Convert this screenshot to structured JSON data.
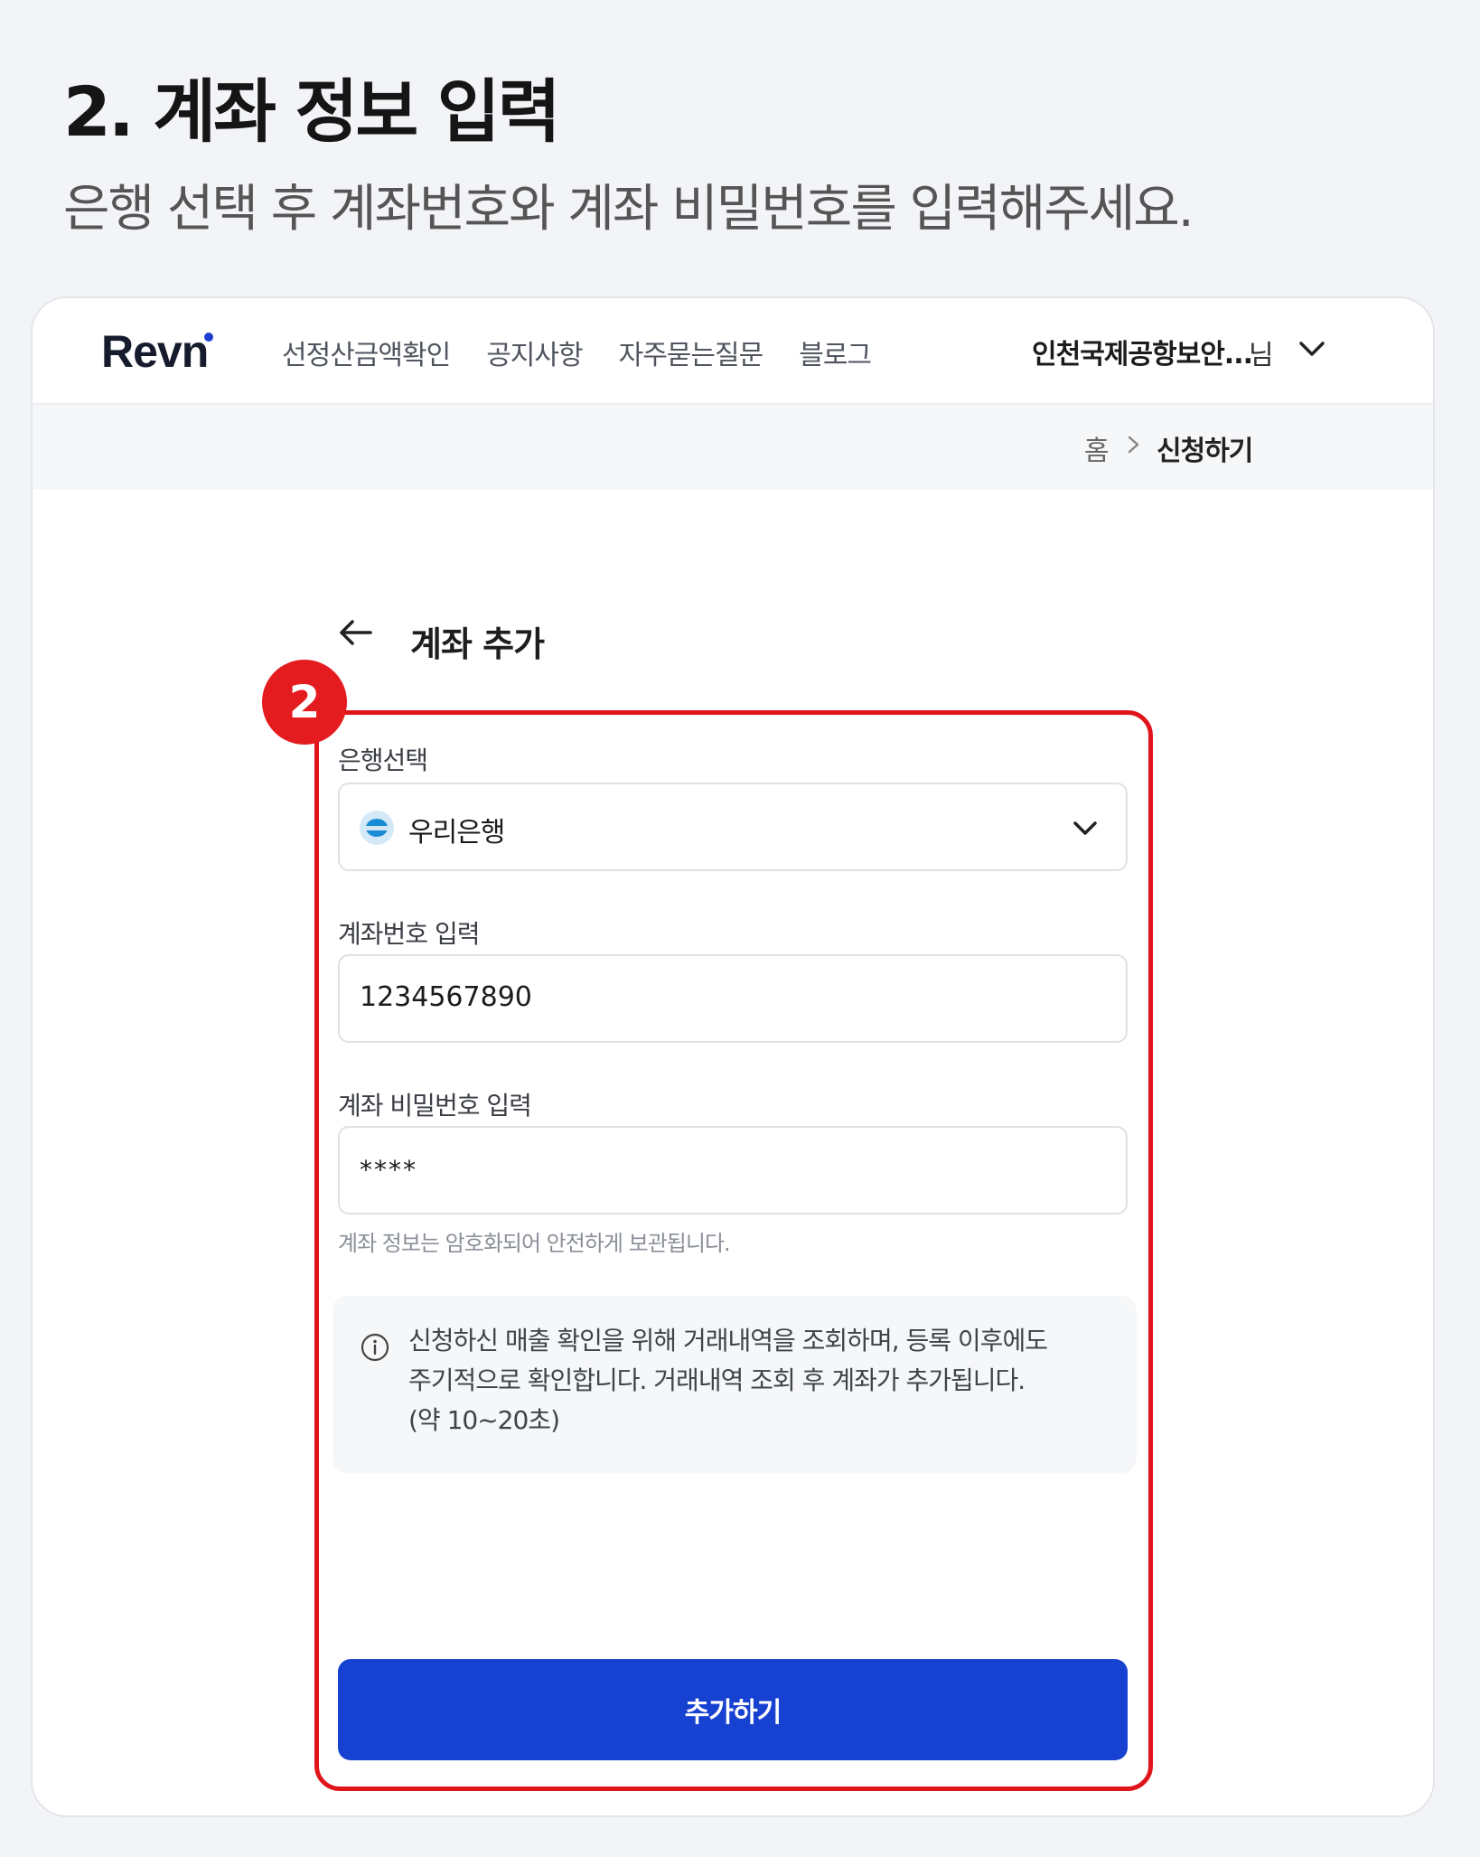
{
  "guide": {
    "title": "2. 계좌 정보 입력",
    "subtitle": "은행 선택 후 계좌번호와 계좌 비밀번호를 입력해주세요."
  },
  "navbar": {
    "logo": "Revn",
    "menu": [
      "선정산금액확인",
      "공지사항",
      "자주묻는질문",
      "블로그"
    ],
    "user_name": "인천국제공항보안...",
    "user_suffix": "님"
  },
  "breadcrumb": {
    "home": "홈",
    "current": "신청하기"
  },
  "form": {
    "title": "계좌 추가",
    "step_badge": "2",
    "bank_label": "은행선택",
    "bank_selected": "우리은행",
    "account_label": "계좌번호 입력",
    "account_value": "1234567890",
    "password_label": "계좌 비밀번호 입력",
    "password_value": "****",
    "helper": "계좌 정보는 암호화되어 안전하게 보관됩니다.",
    "info_lines": [
      "신청하신 매출 확인을 위해 거래내역을 조회하며, 등록 이후에도",
      "주기적으로 확인합니다. 거래내역 조회 후 계좌가 추가됩니다.",
      "(약 10~20초)"
    ],
    "submit_label": "추가하기"
  },
  "icons": {
    "back": "arrow-left-icon",
    "chevron": "chevron-down-icon",
    "breadcrumb_sep": "chevron-right-icon",
    "info": "info-circle-icon",
    "bank": "woori-bank-logo-icon"
  },
  "colors": {
    "accent": "#1741d1",
    "highlight": "#e0151c"
  }
}
